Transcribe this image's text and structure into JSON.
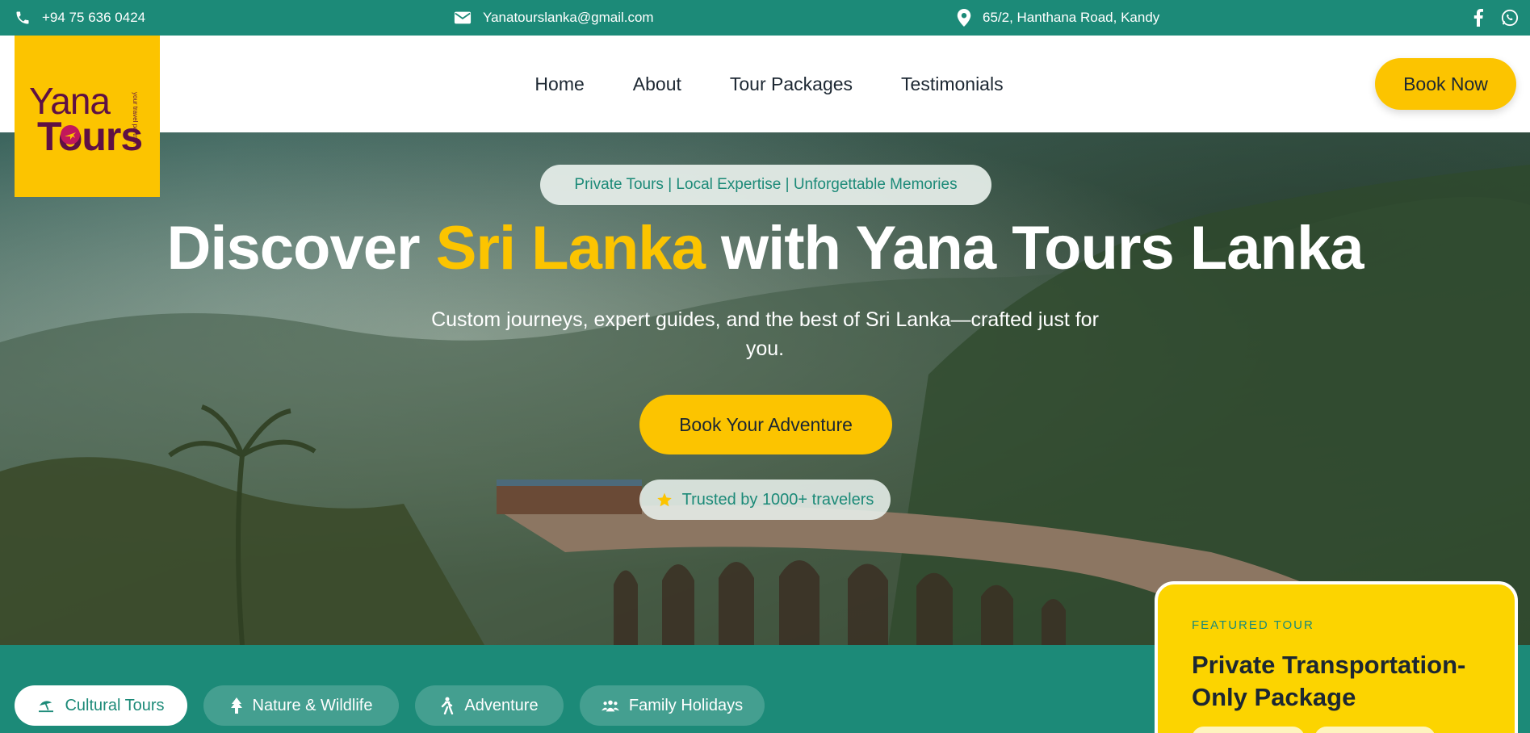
{
  "topbar": {
    "phone": "+94 75 636 0424",
    "email": "Yanatourslanka@gmail.com",
    "address": "65/2, Hanthana Road, Kandy",
    "icons": [
      "phone-icon",
      "mail-icon",
      "location-pin-icon",
      "facebook-icon",
      "whatsapp-icon"
    ]
  },
  "brand": {
    "name_top": "Yana",
    "name_bottom": "Tours",
    "tagline": "your travel partner"
  },
  "nav": {
    "items": [
      "Home",
      "About",
      "Tour Packages",
      "Testimonials"
    ],
    "book_label": "Book Now"
  },
  "hero": {
    "pill": "Private Tours | Local Expertise | Unforgettable Memories",
    "headline_pre": "Discover ",
    "headline_highlight": "Sri Lanka",
    "headline_post": " with Yana Tours Lanka",
    "subline": "Custom journeys, expert guides, and the best of Sri Lanka—crafted just for you.",
    "cta_label": "Book Your Adventure",
    "trusted_label": "Trusted by 1000+ travelers"
  },
  "categories": [
    {
      "label": "Cultural Tours",
      "icon": "umbrella-beach-icon",
      "active": true
    },
    {
      "label": "Nature & Wildlife",
      "icon": "tree-icon",
      "active": false
    },
    {
      "label": "Adventure",
      "icon": "hiking-icon",
      "active": false
    },
    {
      "label": "Family Holidays",
      "icon": "users-icon",
      "active": false
    }
  ],
  "featured": {
    "kicker": "FEATURED TOUR",
    "title": "Private Transportation-Only Package"
  },
  "colors": {
    "teal": "#1c8a78",
    "yellow": "#fcc400",
    "brand_purple": "#5e1044",
    "text_dark": "#1c2732"
  }
}
